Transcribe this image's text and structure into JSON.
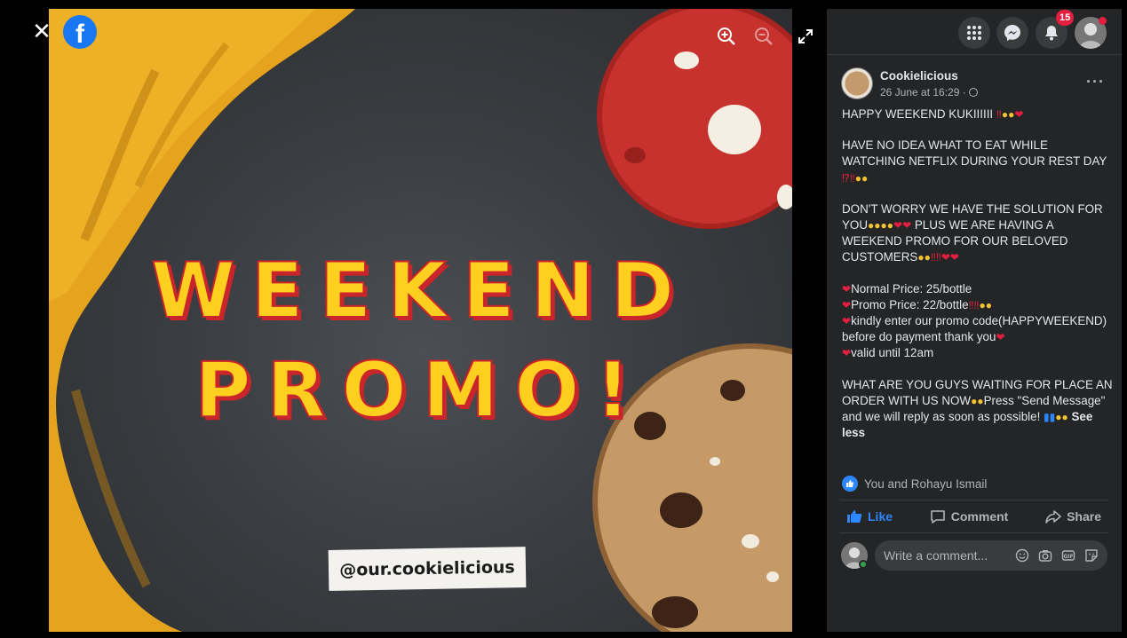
{
  "viewer": {
    "close_label": "✕",
    "logo_letter": "f",
    "headline_1": "WEEKEND",
    "headline_2": "PROMO!",
    "handle": "@our.cookielicious"
  },
  "topbar": {
    "notification_count": "15"
  },
  "post": {
    "page_name": "Cookielicious",
    "time": "26 June at 16:29 ·",
    "more": "···",
    "p1": "HAPPY WEEKEND KUKIIIIII",
    "p2": "HAVE NO IDEA WHAT TO EAT WHILE WATCHING NETFLIX DURING YOUR REST DAY",
    "p3a": "DON'T WORRY WE HAVE THE SOLUTION FOR YOU",
    "p3b": " PLUS WE ARE HAVING A WEEKEND PROMO FOR OUR BELOVED CUSTOMERS",
    "l1": "Normal Price: 25/bottle",
    "l2": "Promo Price: 22/bottle",
    "l3": "kindly enter our promo code(HAPPYWEEKEND) before do payment thank you",
    "l4": "valid until 12am",
    "p5a": "WHAT ARE YOU GUYS WAITING FOR PLACE AN ORDER WITH US NOW",
    "p5b": "Press \"Send Message\" and we will reply as soon as possible!",
    "see_less": "See less"
  },
  "reactions": {
    "text": "You and Rohayu Ismail"
  },
  "actions": {
    "like": "Like",
    "comment": "Comment",
    "share": "Share"
  },
  "comment_box": {
    "placeholder": "Write a comment..."
  },
  "colors": {
    "facebook_blue": "#1877f2",
    "panel_bg": "#242526",
    "like_blue": "#2d88ff",
    "badge_red": "#e41e3f"
  }
}
